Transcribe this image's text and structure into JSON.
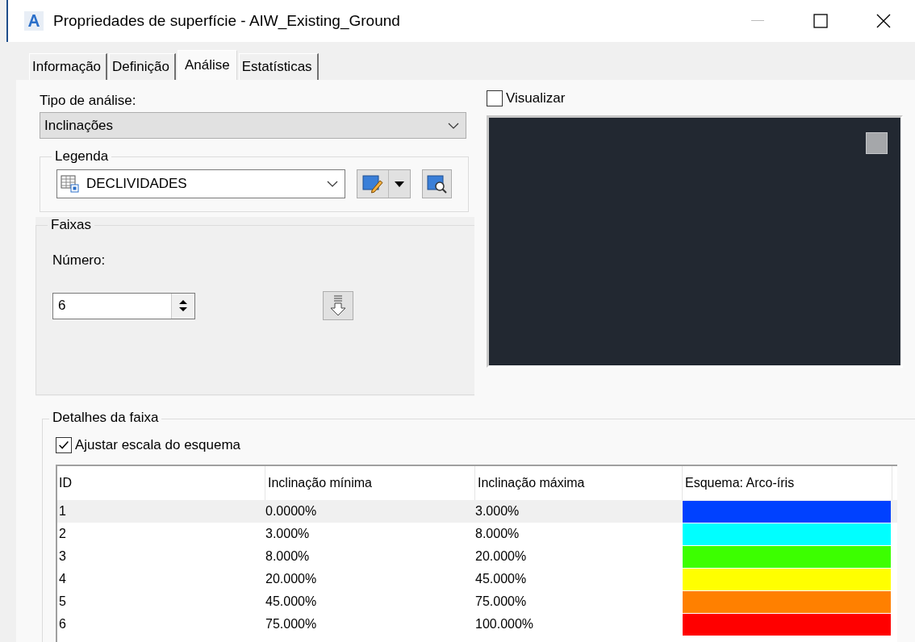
{
  "window": {
    "title": "Propriedades de superfície - AIW_Existing_Ground"
  },
  "tabs": [
    {
      "label": "Informação",
      "selected": false
    },
    {
      "label": "Definição",
      "selected": false
    },
    {
      "label": "Análise",
      "selected": true
    },
    {
      "label": "Estatísticas",
      "selected": false
    }
  ],
  "analysis_type": {
    "label": "Tipo de análise:",
    "value": "Inclinações"
  },
  "legend": {
    "label": "Legenda",
    "value": "DECLIVIDADES"
  },
  "ranges": {
    "label": "Faixas",
    "number_label": "Número:",
    "number": "6"
  },
  "preview": {
    "label": "Visualizar",
    "checked": false
  },
  "range_details": {
    "label": "Detalhes da faixa",
    "scale_scheme": {
      "label": "Ajustar escala do esquema",
      "checked": true
    },
    "columns": [
      "ID",
      "Inclinação mínima",
      "Inclinação máxima",
      "Esquema: Arco-íris"
    ],
    "rows": [
      {
        "id": "1",
        "min": "0.0000%",
        "max": "3.000%",
        "color": "#0041ff",
        "selected": true
      },
      {
        "id": "2",
        "min": "3.000%",
        "max": "8.000%",
        "color": "#00ffff",
        "selected": false
      },
      {
        "id": "3",
        "min": "8.000%",
        "max": "20.000%",
        "color": "#3cff00",
        "selected": false
      },
      {
        "id": "4",
        "min": "20.000%",
        "max": "45.000%",
        "color": "#ffff00",
        "selected": false
      },
      {
        "id": "5",
        "min": "45.000%",
        "max": "75.000%",
        "color": "#ff8000",
        "selected": false
      },
      {
        "id": "6",
        "min": "75.000%",
        "max": "100.000%",
        "color": "#ff0000",
        "selected": false
      }
    ]
  }
}
